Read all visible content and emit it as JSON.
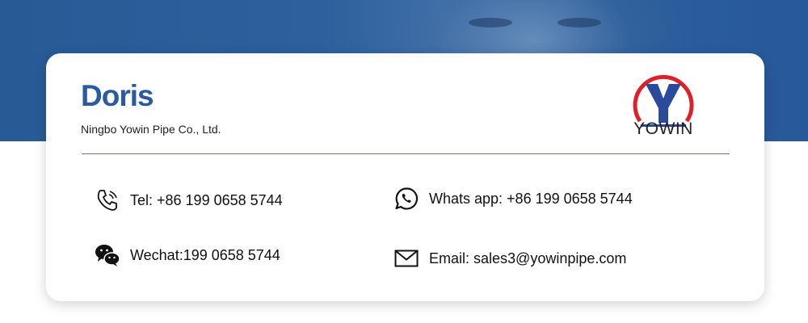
{
  "contact_card": {
    "name": "Doris",
    "company": "Ningbo Yowin Pipe Co., Ltd.",
    "logo": {
      "icon": "yowin-logo-icon",
      "text": "YOWIN",
      "ring_color": "#e02027",
      "letter_color": "#2a4a9c"
    },
    "items": [
      {
        "icon": "phone-icon",
        "text": "Tel: +86 199 0658 5744"
      },
      {
        "icon": "whatsapp-icon",
        "text": "Whats app: +86 199 0658 5744"
      },
      {
        "icon": "wechat-icon",
        "text": "Wechat:199 0658 5744"
      },
      {
        "icon": "email-icon",
        "text": "Email: sales3@yowinpipe.com"
      }
    ]
  },
  "colors": {
    "banner": "#285a96",
    "name": "#2a5aa0",
    "card": "#ffffff"
  }
}
